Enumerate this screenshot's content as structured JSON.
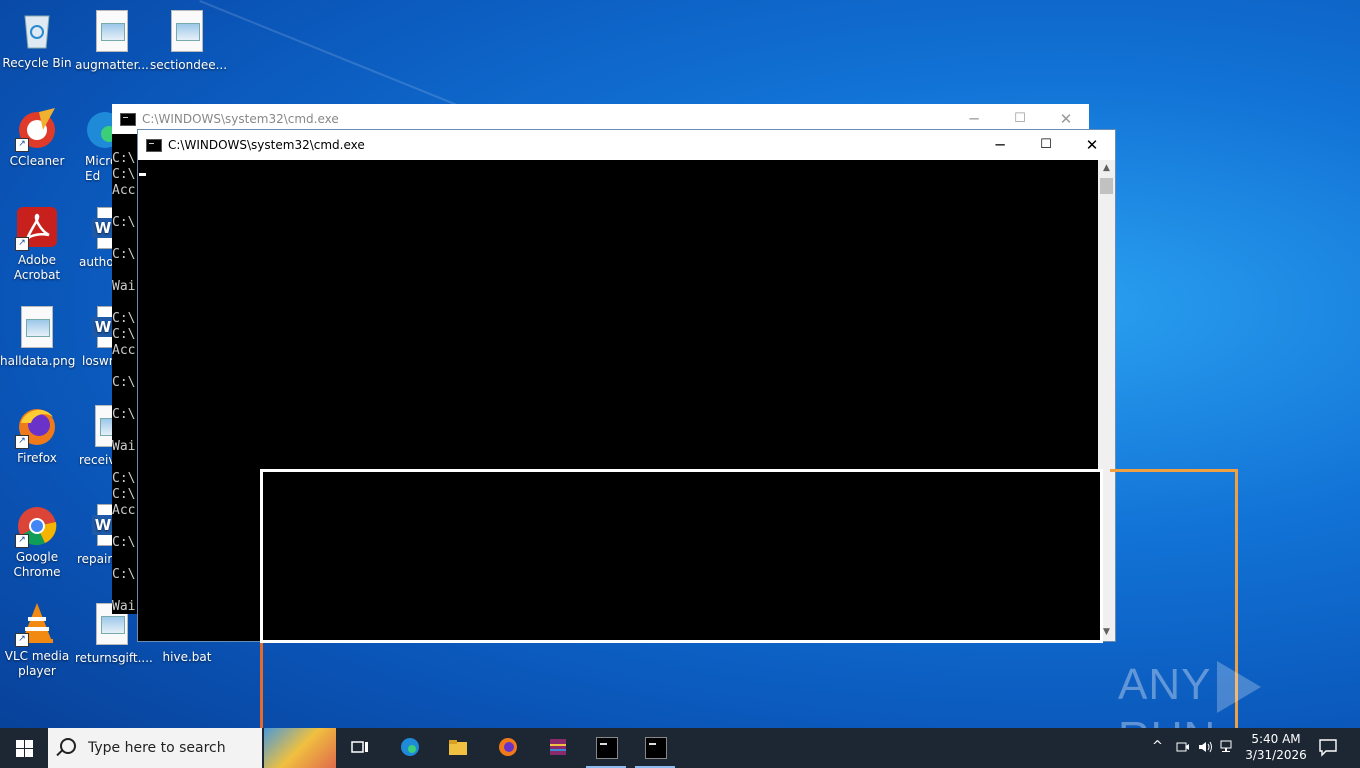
{
  "desktop": {
    "icons": [
      {
        "label": "Recycle Bin"
      },
      {
        "label": "augmatter..."
      },
      {
        "label": "sectiondee..."
      },
      {
        "label": "CCleaner"
      },
      {
        "label": "Micro Ed"
      },
      {
        "label": "Adobe Acrobat"
      },
      {
        "label": "author"
      },
      {
        "label": "halldata.png"
      },
      {
        "label": "loswr"
      },
      {
        "label": "Firefox"
      },
      {
        "label": "receiv"
      },
      {
        "label": "Google Chrome"
      },
      {
        "label": "repairb"
      },
      {
        "label": "VLC media player"
      },
      {
        "label": "returnsgift...."
      },
      {
        "label": "hive.bat"
      }
    ]
  },
  "window_back": {
    "title": "C:\\WINDOWS\\system32\\cmd.exe",
    "lines": "C:\\\nC:\\\nAcc\n\nC:\\\n\nC:\\\n\nWai\n\nC:\\\nC:\\\nAcc\n\nC:\\\n\nC:\\\n\nWai\n\nC:\\\nC:\\\nAcc\n\nC:\\\n\nC:\\\n\nWai"
  },
  "window_front": {
    "title": "C:\\WINDOWS\\system32\\cmd.exe"
  },
  "window_controls": {
    "minimize": "─",
    "maximize": "☐",
    "close": "✕"
  },
  "watermark": {
    "left": "ANY",
    "right": "RUN"
  },
  "taskbar": {
    "search_placeholder": "Type here to search",
    "time": "5:40 AM",
    "date": "3/31/2026"
  },
  "colors": {
    "taskbar": "#1c2733",
    "accent": "#8cbcf0",
    "selection_orange": "#f0a040"
  }
}
